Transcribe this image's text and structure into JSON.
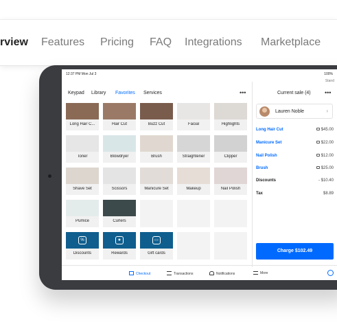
{
  "topnav": {
    "items": [
      "rview",
      "Features",
      "Pricing",
      "FAQ",
      "Integrations",
      "Marketplace"
    ]
  },
  "status": {
    "time": "12:37 PM  Mon Jul 3",
    "right": "100%",
    "stand": "Stand"
  },
  "pos": {
    "tabs": [
      "Keypad",
      "Library",
      "Favorites",
      "Services"
    ],
    "active_tab": "Favorites",
    "more": "•••",
    "tiles": [
      "Long Hair C...",
      "Hair Cut",
      "Buzz Cut",
      "Facial",
      "Highlights",
      "Toner",
      "Blowdryer",
      "Brush",
      "Straightener",
      "Clipper",
      "Shave Set",
      "Scissors",
      "Manicure Set",
      "Makeup",
      "Nail Polish",
      "Pumice",
      "Curlers"
    ],
    "action_tiles": [
      "Discounts",
      "Rewards",
      "Gift cards"
    ]
  },
  "sale": {
    "title": "Current sale (4)",
    "more": "•••",
    "customer": "Lauren Noble",
    "items": [
      {
        "name": "Long Hair Cut",
        "price": "$45.00"
      },
      {
        "name": "Manicure Set",
        "price": "$22.00"
      },
      {
        "name": "Nail Polish",
        "price": "$12.00"
      },
      {
        "name": "Brush",
        "price": "$25.00"
      }
    ],
    "discounts_label": "Discounts",
    "discounts_value": "- $10.40",
    "tax_label": "Tax",
    "tax_value": "$8.89",
    "charge": "Charge $102.49"
  },
  "bottom_nav": [
    "Checkout",
    "Transactions",
    "Notifications",
    "More"
  ],
  "colors": {
    "accent": "#006aff",
    "tile_blue": "#0f5e8e"
  }
}
